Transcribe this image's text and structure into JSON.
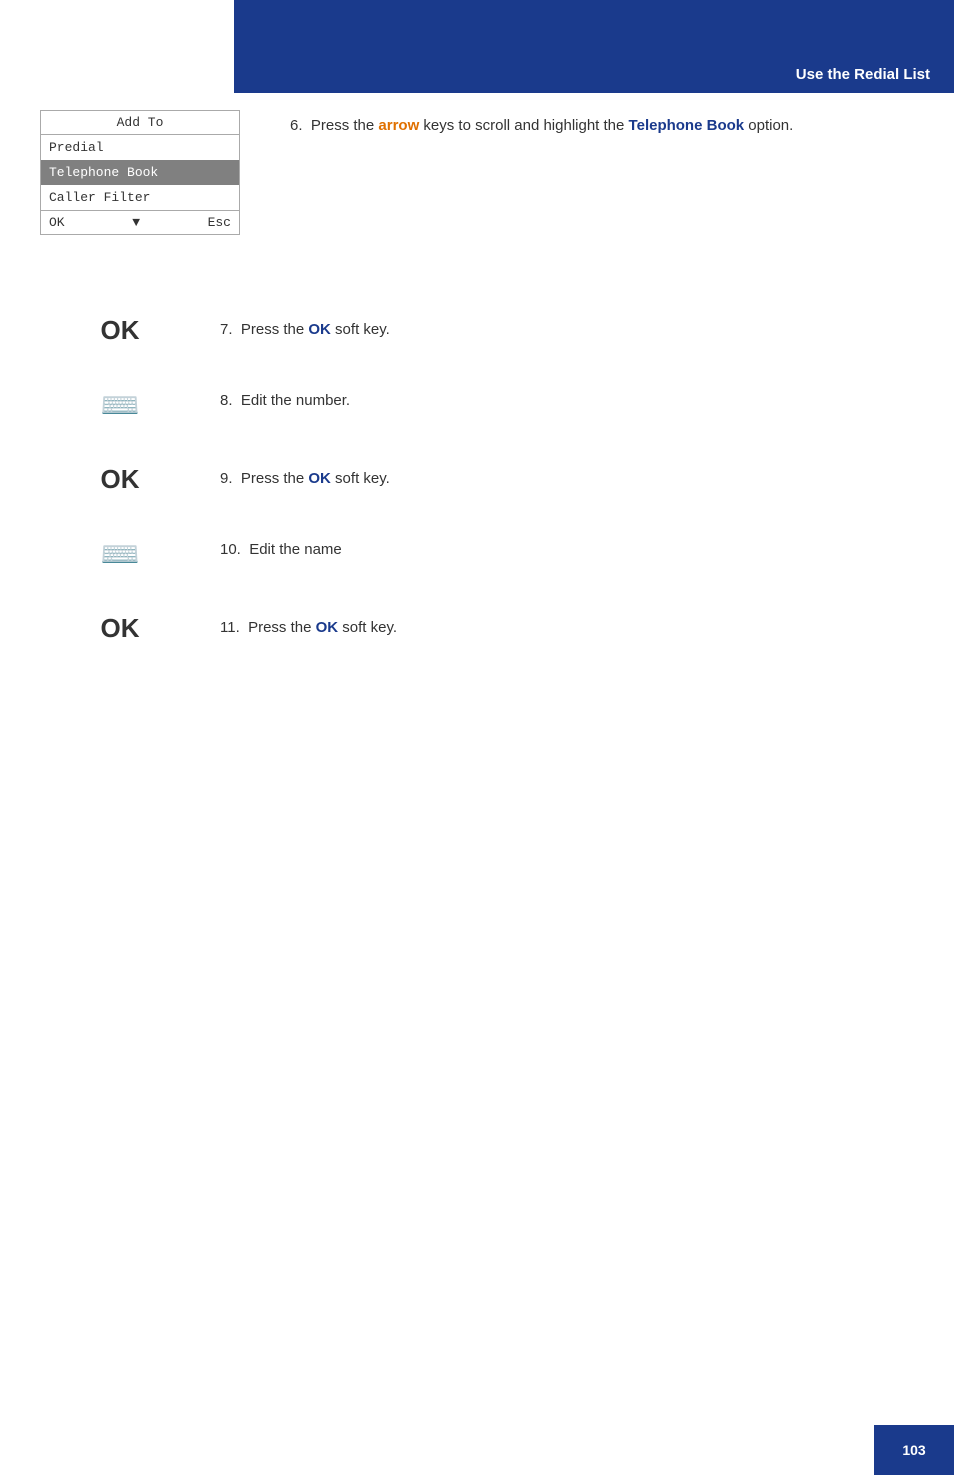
{
  "header": {
    "title": "Use the Redial List",
    "background_color": "#1a3a8c"
  },
  "page_number": "103",
  "menu": {
    "header": "Add To",
    "items": [
      {
        "label": "Predial",
        "highlighted": false
      },
      {
        "label": "Telephone Book",
        "highlighted": true
      },
      {
        "label": "Caller Filter",
        "highlighted": false
      }
    ],
    "footer": {
      "ok": "OK",
      "arrow": "▼",
      "esc": "Esc"
    }
  },
  "steps": [
    {
      "number": "6.",
      "icon_type": "none",
      "text_parts": [
        {
          "text": "Press the ",
          "style": "normal"
        },
        {
          "text": "arrow",
          "style": "orange"
        },
        {
          "text": " keys to scroll and highlight the ",
          "style": "normal"
        },
        {
          "text": "Telephone Book",
          "style": "blue"
        },
        {
          "text": " option.",
          "style": "normal"
        }
      ]
    },
    {
      "number": "7.",
      "icon_type": "ok",
      "icon_label": "OK",
      "text_parts": [
        {
          "text": "Press the ",
          "style": "normal"
        },
        {
          "text": "OK",
          "style": "blue"
        },
        {
          "text": " soft key.",
          "style": "normal"
        }
      ]
    },
    {
      "number": "8.",
      "icon_type": "keyboard",
      "text_parts": [
        {
          "text": "Edit the number.",
          "style": "normal"
        }
      ]
    },
    {
      "number": "9.",
      "icon_type": "ok",
      "icon_label": "OK",
      "text_parts": [
        {
          "text": "Press the ",
          "style": "normal"
        },
        {
          "text": "OK",
          "style": "blue"
        },
        {
          "text": " soft key.",
          "style": "normal"
        }
      ]
    },
    {
      "number": "10.",
      "icon_type": "keyboard",
      "text_parts": [
        {
          "text": "Edit the name",
          "style": "normal"
        }
      ]
    },
    {
      "number": "11.",
      "icon_type": "ok",
      "icon_label": "OK",
      "text_parts": [
        {
          "text": "Press the ",
          "style": "normal"
        },
        {
          "text": "OK",
          "style": "blue"
        },
        {
          "text": " soft key.",
          "style": "normal"
        }
      ]
    }
  ]
}
